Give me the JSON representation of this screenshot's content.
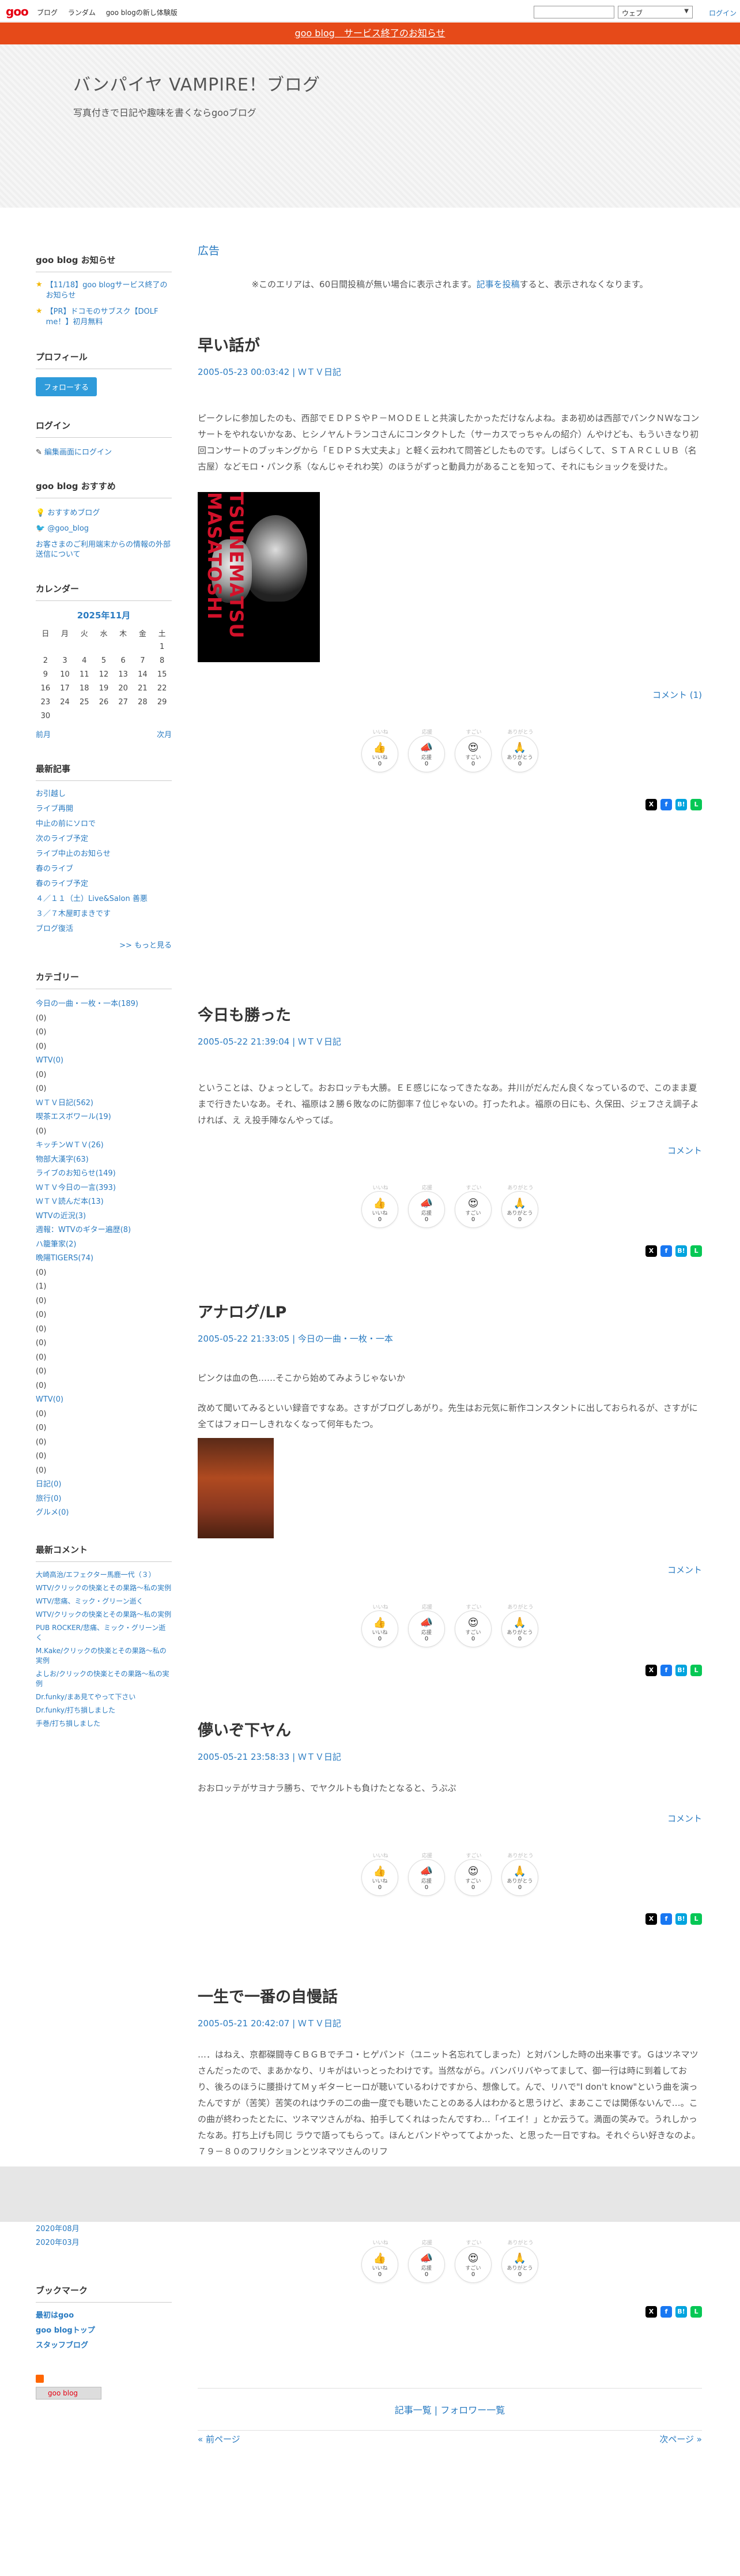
{
  "topbar": {
    "logo": "goo",
    "nav": [
      "ブログ",
      "ランダム",
      "goo blogの新し体験版"
    ],
    "search_engine": "ウェブ",
    "login": "ログイン"
  },
  "notice": "goo blog　サービス終了のお知らせ",
  "header": {
    "title": "バンパイヤ VAMPIRE！ブログ",
    "description": "写真付きで日記や趣味を書くならgooブログ"
  },
  "main": {
    "ad": "広告",
    "ad_note_pre": "※このエリアは、60日間投稿が無い場合に表示されます。",
    "ad_note_link": "記事を投稿",
    "ad_note_post": "すると、表示されなくなります。"
  },
  "reactions": [
    {
      "label": "いいね",
      "top": "いいね",
      "icon": "👍",
      "count": "0"
    },
    {
      "label": "応援",
      "top": "応援",
      "icon": "📣",
      "count": "0"
    },
    {
      "label": "すごい",
      "top": "すごい",
      "icon": "😍",
      "count": "0"
    },
    {
      "label": "ありがとう",
      "top": "ありがとう",
      "icon": "🙏",
      "count": "0"
    }
  ],
  "posts": [
    {
      "title": "早い話が",
      "date": "2005-05-23 00:03:42",
      "category": "ＷＴＶ日記",
      "body": "ピークレに参加したのも、西部でＥＤＰＳやＰ－ＭＯＤＥＬと共演したかっただけなんよね。まあ初めは西部でパンクＮＷなコンサートをやれないかなあ、ヒシノヤんトランコさんにコンタクトした（サーカスでっちゃんの紹介）んやけども、もういきなり初回コンサートのブッキングから「ＥＤＰＳ大丈夫よ」と軽く云われて問答どしたものです。しばらくして、ＳＴＡＲＣＬＵＢ（名古屋）などモロ・パンク系（なんじゃそれわ笑）のほうがずっと動員力があることを知って、それにもショックを受けた。",
      "photo_text": "TSUNEMATSU MASATOSHI",
      "comment": "コメント (1)"
    },
    {
      "title": "今日も勝った",
      "date": "2005-05-22 21:39:04",
      "category": "ＷＴＶ日記",
      "body": "ということは、ひょっとして。おおロッテも大勝。ＥＥ感じになってきたなあ。井川がだんだん良くなっているので、このまま夏まで行きたいなあ。それ、福原は２勝６敗なのに防御率７位じゃないの。打ったれよ。福原の日にも、久保田、ジェフさえ調子よければ、え え投手陣なんやってば。",
      "comment": "コメント"
    },
    {
      "title": "アナログ/LP",
      "date": "2005-05-22 21:33:05",
      "category": "今日の一曲・一枚・一本",
      "body1": "ピンクは血の色……そこから始めてみようじゃないか",
      "body2": "改めて聞いてみるといい録音ですなあ。さすがブログしあがり。先生はお元気に新作コンスタントに出しておられるが、さすがに全てはフォローしきれなくなって何年もたつ。",
      "comment": "コメント"
    },
    {
      "title": "儚いぞ下ヤん",
      "date": "2005-05-21 23:58:33",
      "category": "ＷＴＶ日記",
      "body": "おおロッテがサヨナラ勝ち、でヤクルトも負けたとなると、うぷぷ",
      "comment": "コメント"
    },
    {
      "title": "一生で一番の自慢話",
      "date": "2005-05-21 20:42:07",
      "category": "ＷＴＶ日記",
      "body": "…．はねえ、京都磔闘寺ＣＢＧＢでチコ・ヒゲパンド（ユニット名忘れてしまった）と対バンした時の出来事です。Ｇはツネマツさんだったので、まあかなり、リキがはいっとったわけです。当然ながら。バンバリバやってまして、御一行は時に到着しており、後ろのほうに腰掛けてＭｙギターヒーロが聴いているわけですから、想像して。んで、リハで\"I don't know\"という曲を演ったんですが（苦笑）苦笑のれはウチの二の曲一度でも聴いたことのある人はわかると思うけど、まあここでは関係ないんで…。この曲が終わったとたに、ツネマツさんがね、拍手してくれはったんですわ…「イエイ！」とか云うて。満面の笑みで。うれしかったなあ。打ち上げも同じ ラウで語ってもらって。ほんとバンドやっててよかった、と思った一日ですね。それぐらい好きなのよ。７９－８０のフリクションとツネマツさんのリフ"
    }
  ],
  "sidebar": {
    "notice": {
      "title": "goo blog お知らせ",
      "items": [
        "【11/18】goo blogサービス終了のお知らせ",
        "【PR】ドコモのサブスク【DOLF me！】初月無料"
      ]
    },
    "profile": {
      "title": "プロフィール",
      "button": "フォローする"
    },
    "login": {
      "title": "ログイン",
      "link": "編集画面にログイン"
    },
    "recommend": {
      "title": "goo blog おすすめ",
      "items": [
        "おすすめブログ",
        "@goo_blog",
        "お客さまのご利用端末からの情報の外部送信について"
      ]
    },
    "calendar": {
      "title": "カレンダー",
      "month": "2025年11月",
      "weekdays": [
        "日",
        "月",
        "火",
        "水",
        "木",
        "金",
        "土"
      ],
      "rows": [
        [
          "",
          "",
          "",
          "",
          "",
          "",
          "1"
        ],
        [
          "2",
          "3",
          "4",
          "5",
          "6",
          "7",
          "8"
        ],
        [
          "9",
          "10",
          "11",
          "12",
          "13",
          "14",
          "15"
        ],
        [
          "16",
          "17",
          "18",
          "19",
          "20",
          "21",
          "22"
        ],
        [
          "23",
          "24",
          "25",
          "26",
          "27",
          "28",
          "29"
        ],
        [
          "30",
          "",
          "",
          "",
          "",
          "",
          ""
        ]
      ],
      "prev": "前月",
      "next": "次月"
    },
    "recent": {
      "title": "最新記事",
      "items": [
        "お引越し",
        "ライブ再開",
        "中止の前にソロで",
        "次のライブ予定",
        "ライブ中止のお知らせ",
        "春のライブ",
        "春のライブ予定",
        "４／１１（土）Live&Salon 善悪",
        "３／７木屋町まきです",
        "ブログ復活"
      ],
      "more": ">> もっと見る"
    },
    "categories": {
      "title": "カテゴリー",
      "items": [
        "今日の一曲・一枚・一本(189)",
        "(0)",
        "(0)",
        "(0)",
        "WTV(0)",
        "(0)",
        "(0)",
        "ＷＴＶ日記(562)",
        "喫茶エスボワール(19)",
        "(0)",
        "キッチンＷＴＶ(26)",
        "物部大漢字(63)",
        "ライブのお知らせ(149)",
        "ＷＴＶ今日の一言(393)",
        "ＷＴＶ読んだ本(13)",
        "WTVの近況(3)",
        "週報：WTVのギター遍歴(8)",
        "ハ籠筆家(2)",
        "晩陽TIGERS(74)",
        "(0)",
        "(1)",
        "(0)",
        "(0)",
        "(0)",
        "(0)",
        "(0)",
        "(0)",
        "(0)",
        "WTV(0)",
        "(0)",
        "(0)",
        "(0)",
        "(0)",
        "(0)",
        "日記(0)",
        "旅行(0)",
        "グルメ(0)"
      ]
    },
    "comments": {
      "title": "最新コメント",
      "items": [
        "大崎高治/エフェクター馬鹿一代（３）",
        "WTV/クリックの快楽とその果路〜私の実例",
        "WTV/悲痛、ミック・グリーン逝く",
        "WTV/クリックの快楽とその果路〜私の実例",
        "PUB ROCKER/悲痛、ミック・グリーン逝く",
        "M.Kake/クリックの快楽とその果路〜私の実例",
        "よしお/クリックの快楽とその果路〜私の実例",
        "Dr.funky/まあ見てやって下さい",
        "Dr.funky/打ち損しました",
        "手巻/打ち損しました"
      ]
    },
    "archive": [
      "2020年08月",
      "2020年03月"
    ],
    "bookmark": {
      "title": "ブックマーク",
      "items": [
        "最初はgoo",
        "goo blogトップ",
        "スタッフブログ"
      ],
      "badge": "goo blog"
    }
  },
  "footer": {
    "links": "記事一覧 | フォロワー一覧",
    "prev": "« 前ページ",
    "next": "次ページ »"
  }
}
